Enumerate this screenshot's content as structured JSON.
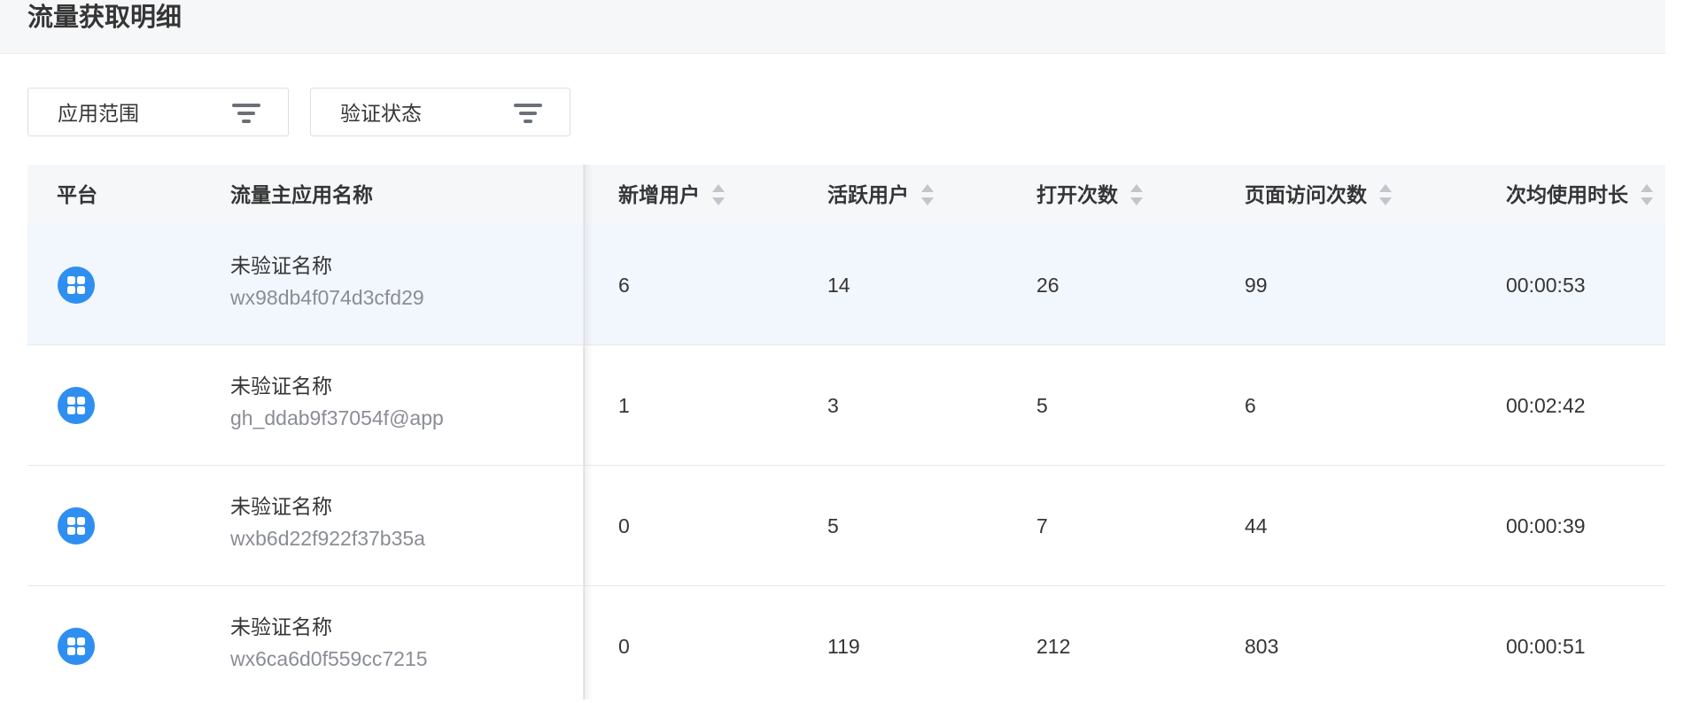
{
  "header": {
    "title": "流量获取明细"
  },
  "filters": [
    {
      "label": "应用范围",
      "icon": "filter-icon"
    },
    {
      "label": "验证状态",
      "icon": "filter-icon"
    }
  ],
  "table": {
    "columns": {
      "platform": "平台",
      "app_name": "流量主应用名称",
      "new_users": "新增用户",
      "active_users": "活跃用户",
      "opens": "打开次数",
      "page_views": "页面访问次数",
      "avg_duration": "次均使用时长"
    },
    "rows": [
      {
        "platform_icon": "mini-program-icon",
        "name": "未验证名称",
        "app_id": "wx98db4f074d3cfd29",
        "new_users": "6",
        "active_users": "14",
        "opens": "26",
        "page_views": "99",
        "avg_duration": "00:00:53"
      },
      {
        "platform_icon": "mini-program-icon",
        "name": "未验证名称",
        "app_id": "gh_ddab9f37054f@app",
        "new_users": "1",
        "active_users": "3",
        "opens": "5",
        "page_views": "6",
        "avg_duration": "00:02:42"
      },
      {
        "platform_icon": "mini-program-icon",
        "name": "未验证名称",
        "app_id": "wxb6d22f922f37b35a",
        "new_users": "0",
        "active_users": "5",
        "opens": "7",
        "page_views": "44",
        "avg_duration": "00:00:39"
      },
      {
        "platform_icon": "mini-program-icon",
        "name": "未验证名称",
        "app_id": "wx6ca6d0f559cc7215",
        "new_users": "0",
        "active_users": "119",
        "opens": "212",
        "page_views": "803",
        "avg_duration": "00:00:51"
      }
    ]
  },
  "colors": {
    "accent": "#2f8ff0",
    "header_bg": "#f6f7f9",
    "row_hover_bg": "#f2f6fd",
    "muted_text": "#8a8d94"
  }
}
